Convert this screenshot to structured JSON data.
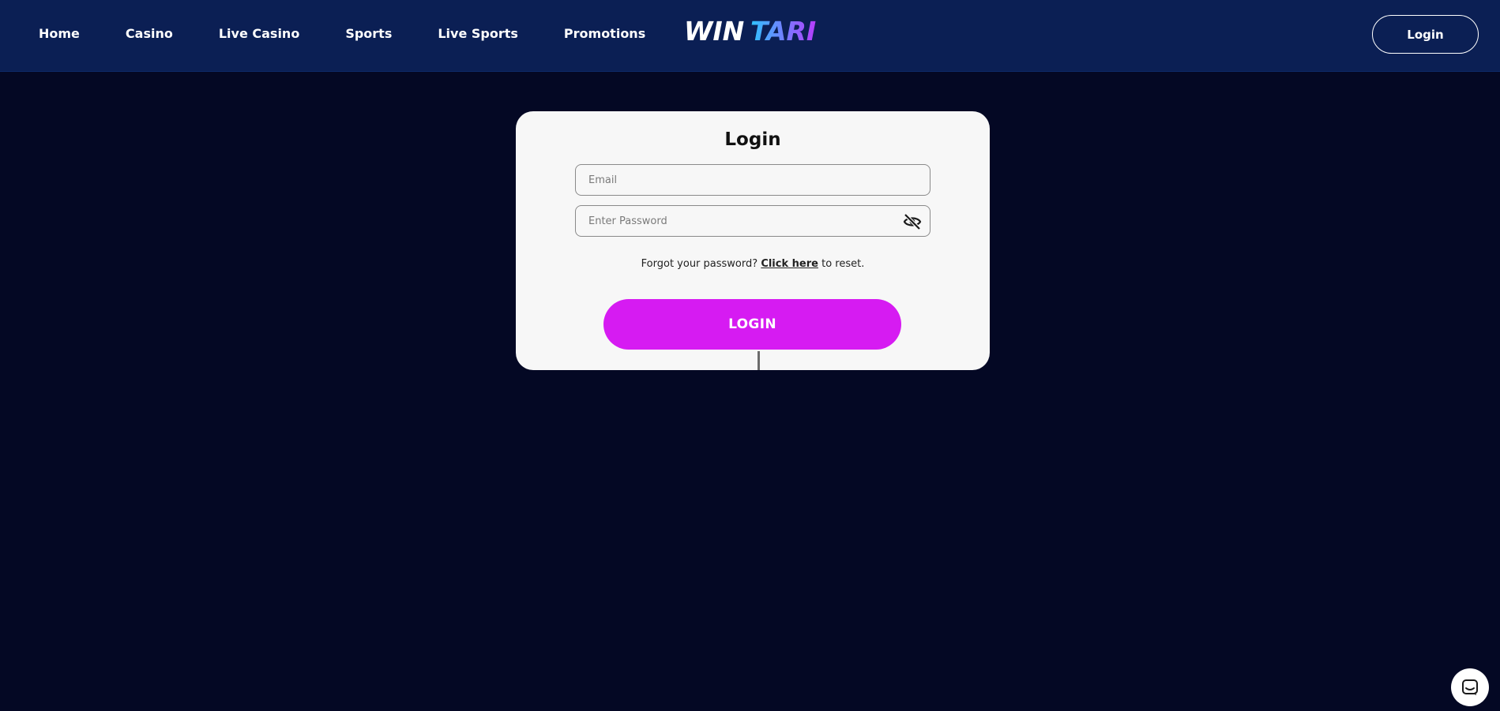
{
  "nav": {
    "items": [
      {
        "label": "Home"
      },
      {
        "label": "Casino"
      },
      {
        "label": "Live Casino"
      },
      {
        "label": "Sports"
      },
      {
        "label": "Live Sports"
      },
      {
        "label": "Promotions"
      }
    ]
  },
  "logo": {
    "text_part1": "WIN",
    "text_part2": "TARI",
    "color_part1": "#ffffff",
    "gradient_start": "#2ec4ff",
    "gradient_end": "#b63cff"
  },
  "header": {
    "login_label": "Login"
  },
  "login_card": {
    "title": "Login",
    "email_placeholder": "Email",
    "password_placeholder": "Enter Password",
    "forgot_prefix": "Forgot your password?",
    "forgot_link": "Click here",
    "forgot_suffix": "to reset.",
    "submit_label": "LOGIN"
  },
  "colors": {
    "background": "#040824",
    "header_bg": "#0b1f54",
    "card_bg": "#f7f7f7",
    "accent": "#d61bf2"
  },
  "icons": {
    "password_toggle": "eye-slash-icon",
    "chat": "chat-icon"
  }
}
